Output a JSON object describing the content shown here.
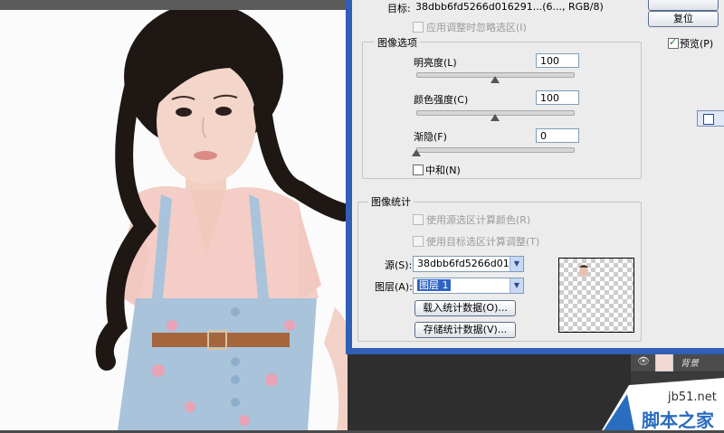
{
  "dialog": {
    "target_label": "目标:",
    "target_value": "38dbb6fd5266d016291...(6..., RGB/8)",
    "apply_selection_label": "应用调整时忽略选区(I)",
    "image_options": {
      "title": "图像选项",
      "luminance": {
        "label": "明亮度(L)",
        "value": "100",
        "slider_fraction": 0.5
      },
      "color_intensity": {
        "label": "颜色强度(C)",
        "value": "100",
        "slider_fraction": 0.5
      },
      "fade": {
        "label": "渐隐(F)",
        "value": "0",
        "slider_fraction": 0.0
      },
      "neutralize": {
        "label": "中和(N)",
        "checked": false
      }
    },
    "image_statistics": {
      "title": "图像统计",
      "use_selection_source": "使用源选区计算颜色(R)",
      "use_selection_target": "使用目标选区计算调整(T)",
      "source_label": "源(S):",
      "source_value": "38dbb6fd5266d01...",
      "layer_label": "图层(A):",
      "layer_value": "图层 1",
      "load_stats_button": "载入统计数据(O)...",
      "save_stats_button": "存储统计数据(V)..."
    },
    "buttons": {
      "reset": "复位"
    },
    "preview": {
      "label": "预览(P)",
      "checked": true
    }
  },
  "layers_panel": {
    "background_layer_name": "背景"
  },
  "watermark": {
    "site": "jb51.net",
    "name": "脚本之家"
  },
  "colors": {
    "dialog_border": "#2f5fb6",
    "dialog_bg": "#ececec",
    "watermark_blue": "#2a6cc0"
  }
}
